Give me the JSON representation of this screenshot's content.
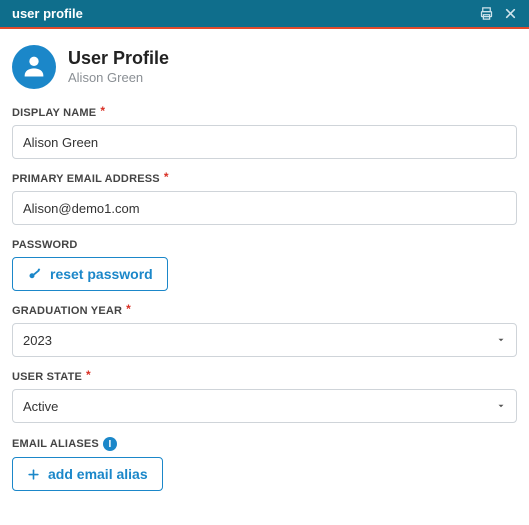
{
  "header": {
    "title": "user profile"
  },
  "profile": {
    "heading": "User Profile",
    "name": "Alison Green"
  },
  "fields": {
    "display_name": {
      "label": "DISPLAY NAME",
      "required": true,
      "value": "Alison Green"
    },
    "primary_email": {
      "label": "PRIMARY EMAIL ADDRESS",
      "required": true,
      "value": "Alison@demo1.com"
    },
    "password": {
      "label": "PASSWORD",
      "reset_button": "reset password"
    },
    "graduation_year": {
      "label": "GRADUATION YEAR",
      "required": true,
      "value": "2023"
    },
    "user_state": {
      "label": "USER STATE",
      "required": true,
      "value": "Active"
    },
    "email_aliases": {
      "label": "EMAIL ALIASES",
      "add_button": "add email alias"
    }
  },
  "icons": {
    "print": "print-icon",
    "close": "close-icon",
    "user": "user-icon",
    "key": "key-icon",
    "info": "info-icon",
    "plus": "plus-icon",
    "caret": "caret-down-icon"
  },
  "colors": {
    "header_bg": "#0f6e8c",
    "accent_border": "#e24a2b",
    "primary": "#1b87c9",
    "required": "#d93025"
  }
}
